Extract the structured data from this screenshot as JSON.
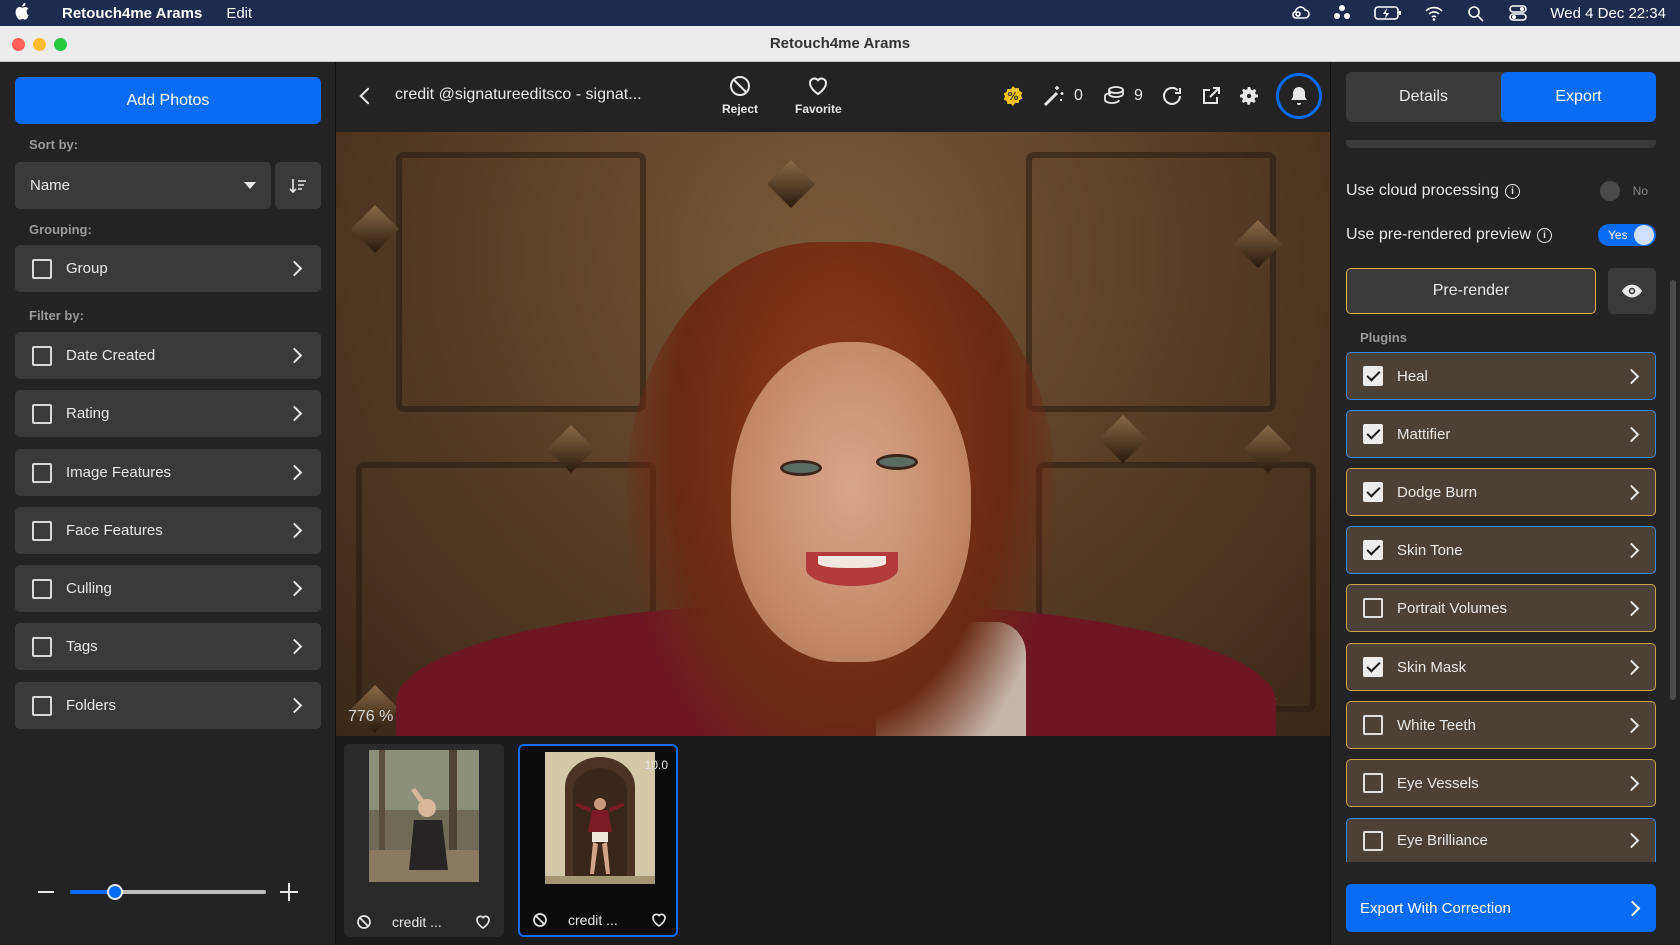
{
  "menubar": {
    "app_name": "Retouch4me Arams",
    "menus": [
      "Edit"
    ],
    "clock": "Wed 4 Dec  22:34",
    "icons": [
      "creative-cloud-icon",
      "users-icon",
      "battery-icon",
      "wifi-icon",
      "search-icon",
      "control-center-icon"
    ]
  },
  "window": {
    "title": "Retouch4me Arams"
  },
  "sidebar": {
    "add_photos": "Add Photos",
    "sort_label": "Sort by:",
    "sort_value": "Name",
    "grouping_label": "Grouping:",
    "group": "Group",
    "filter_label": "Filter by:",
    "filters": [
      "Date Created",
      "Rating",
      "Image Features",
      "Face Features",
      "Culling",
      "Tags",
      "Folders"
    ],
    "zoom_level": 0.23
  },
  "toolbar": {
    "photo_title": "credit @signatureeditsco - signat...",
    "reject": "Reject",
    "favorite": "Favorite",
    "wand_count": "0",
    "coins_count": "9"
  },
  "canvas": {
    "zoom": "776 %"
  },
  "filmstrip": {
    "items": [
      {
        "name": "credit ...",
        "score": "",
        "selected": false
      },
      {
        "name": "credit ...",
        "score": "10.0",
        "selected": true
      }
    ]
  },
  "right_panel": {
    "tabs": [
      "Details",
      "Export"
    ],
    "active_tab": "Export",
    "cloud_processing": {
      "label": "Use cloud processing",
      "state": "No"
    },
    "prerendered_preview": {
      "label": "Use pre-rendered preview",
      "state": "Yes"
    },
    "prerender_button": "Pre-render",
    "plugins_label": "Plugins",
    "plugins": [
      {
        "label": "Heal",
        "checked": true
      },
      {
        "label": "Mattifier",
        "checked": true
      },
      {
        "label": "Dodge Burn",
        "checked": true
      },
      {
        "label": "Skin Tone",
        "checked": true
      },
      {
        "label": "Portrait Volumes",
        "checked": false
      },
      {
        "label": "Skin Mask",
        "checked": true
      },
      {
        "label": "White Teeth",
        "checked": false
      },
      {
        "label": "Eye Vessels",
        "checked": false
      },
      {
        "label": "Eye Brilliance",
        "checked": false
      }
    ],
    "export_button": "Export With Correction"
  },
  "colors": {
    "accent": "#0a6bf5",
    "gold_border": "#c9a246",
    "panel": "#232323"
  }
}
